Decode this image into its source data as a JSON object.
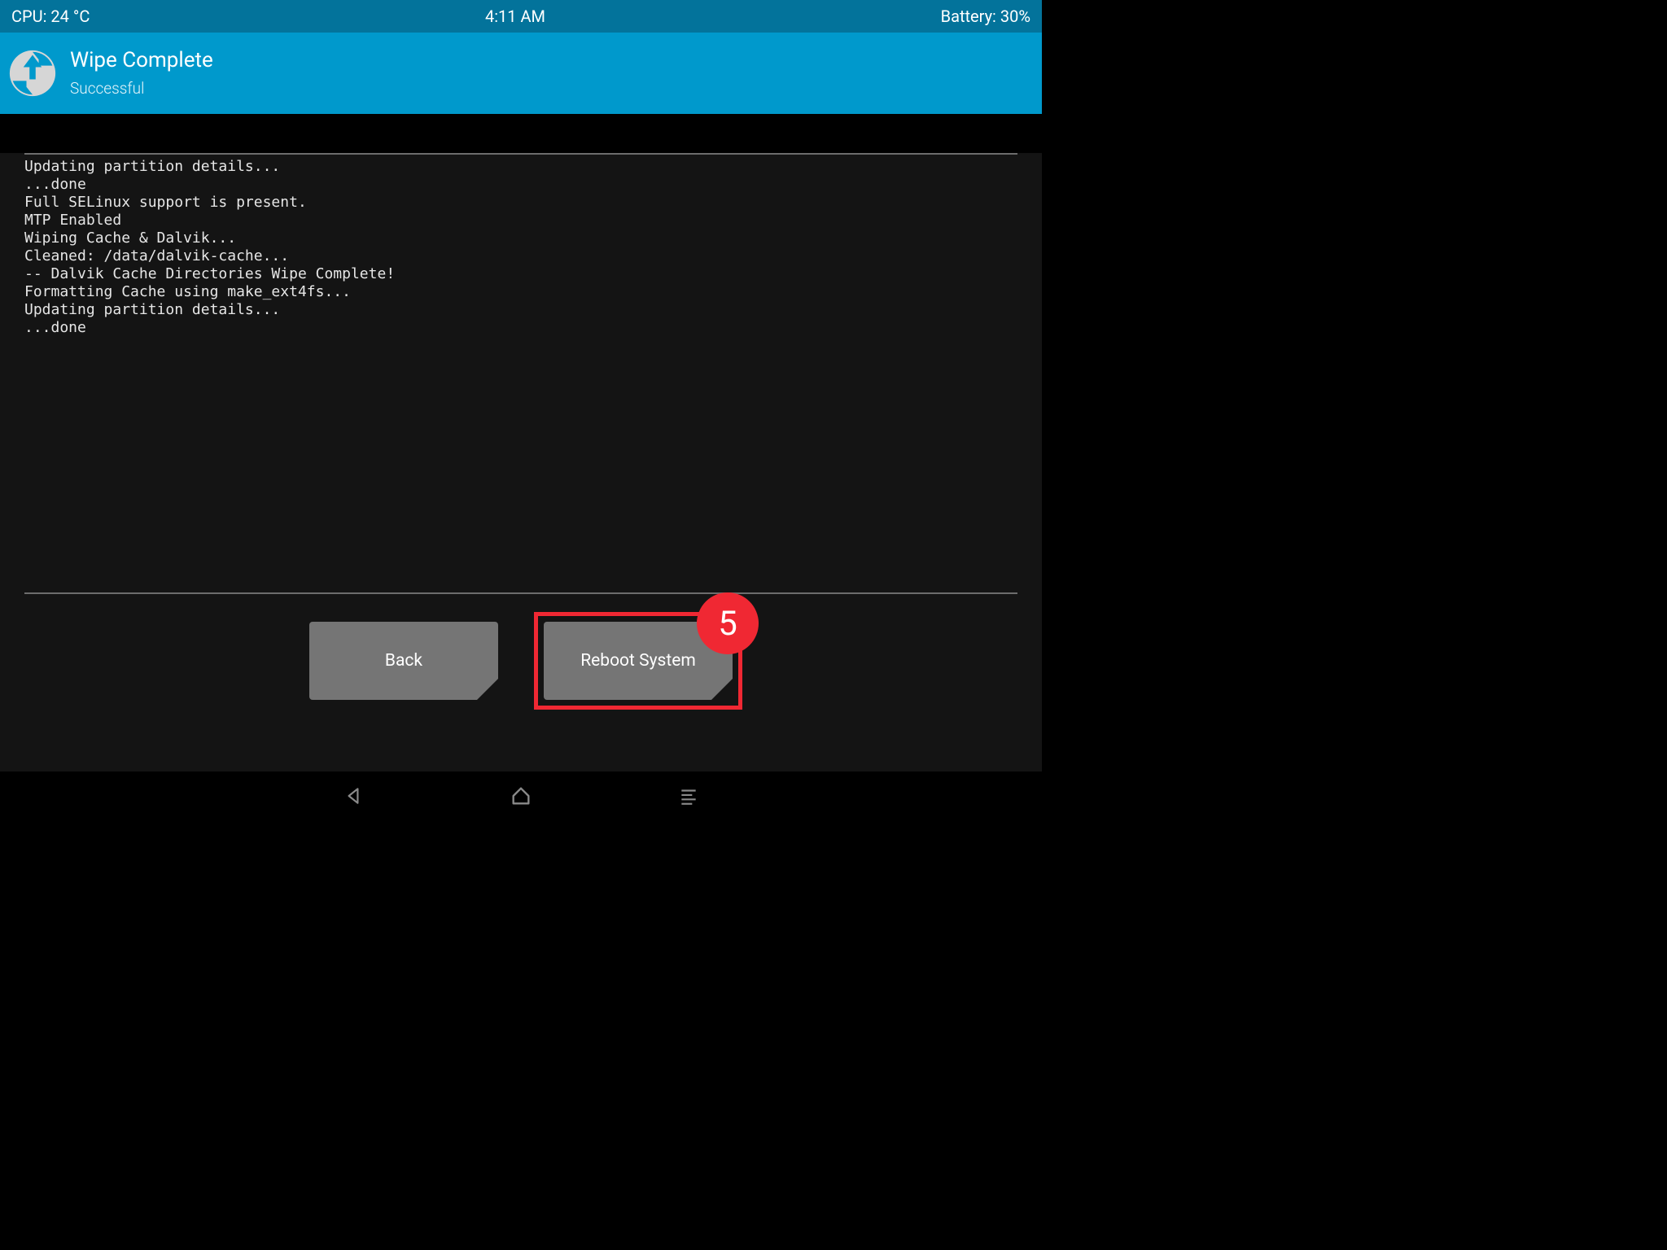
{
  "status": {
    "cpu": "CPU: 24 °C",
    "time": "4:11 AM",
    "battery": "Battery: 30%"
  },
  "header": {
    "title": "Wipe Complete",
    "subtitle": "Successful"
  },
  "log": [
    "Updating partition details...",
    "...done",
    "Full SELinux support is present.",
    "MTP Enabled",
    "Wiping Cache & Dalvik...",
    "Cleaned: /data/dalvik-cache...",
    "-- Dalvik Cache Directories Wipe Complete!",
    "Formatting Cache using make_ext4fs...",
    "Updating partition details...",
    "...done"
  ],
  "buttons": {
    "back": "Back",
    "reboot": "Reboot System"
  },
  "annotation": {
    "step": "5"
  }
}
